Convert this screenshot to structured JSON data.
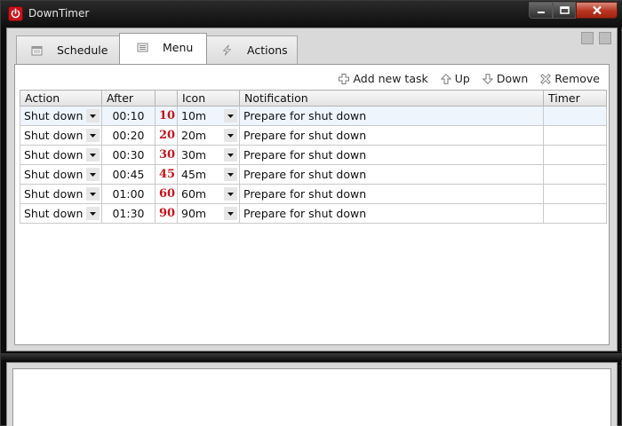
{
  "window": {
    "title": "DownTimer",
    "icon": "power-icon",
    "accent_color": "#c8131a"
  },
  "tabs": [
    {
      "label": "Schedule",
      "icon": "calendar-icon",
      "active": false
    },
    {
      "label": "Menu",
      "icon": "list-icon",
      "active": true
    },
    {
      "label": "Actions",
      "icon": "lightning-icon",
      "active": false
    }
  ],
  "toolbar": {
    "add_label": "Add new task",
    "up_label": "Up",
    "down_label": "Down",
    "remove_label": "Remove"
  },
  "grid": {
    "columns": [
      "Action",
      "After",
      "",
      "Icon",
      "Notification",
      "Timer"
    ],
    "rows": [
      {
        "action": "Shut down",
        "after": "00:10",
        "num": "10",
        "icon": "10m",
        "notification": "Prepare for shut down",
        "timer": ""
      },
      {
        "action": "Shut down",
        "after": "00:20",
        "num": "20",
        "icon": "20m",
        "notification": "Prepare for shut down",
        "timer": ""
      },
      {
        "action": "Shut down",
        "after": "00:30",
        "num": "30",
        "icon": "30m",
        "notification": "Prepare for shut down",
        "timer": ""
      },
      {
        "action": "Shut down",
        "after": "00:45",
        "num": "45",
        "icon": "45m",
        "notification": "Prepare for shut down",
        "timer": ""
      },
      {
        "action": "Shut down",
        "after": "01:00",
        "num": "60",
        "icon": "60m",
        "notification": "Prepare for shut down",
        "timer": ""
      },
      {
        "action": "Shut down",
        "after": "01:30",
        "num": "90",
        "icon": "90m",
        "notification": "Prepare for shut down",
        "timer": ""
      }
    ]
  }
}
